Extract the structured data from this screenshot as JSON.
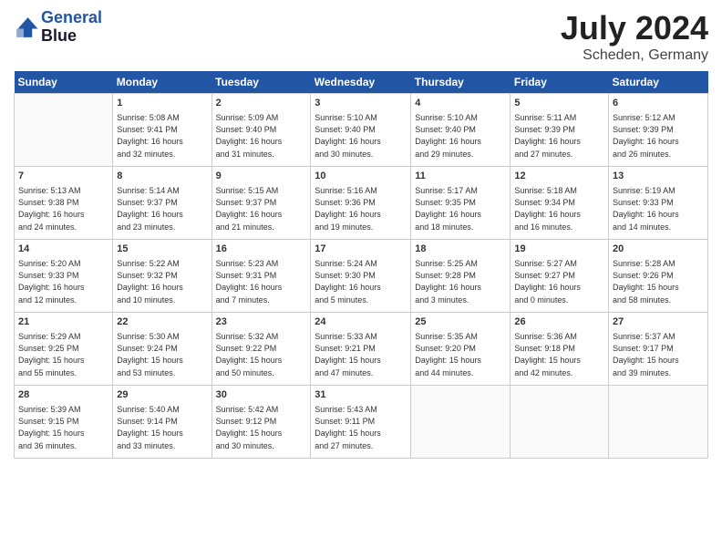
{
  "header": {
    "logo_line1": "General",
    "logo_line2": "Blue",
    "month": "July 2024",
    "location": "Scheden, Germany"
  },
  "weekdays": [
    "Sunday",
    "Monday",
    "Tuesday",
    "Wednesday",
    "Thursday",
    "Friday",
    "Saturday"
  ],
  "weeks": [
    [
      {
        "day": "",
        "info": ""
      },
      {
        "day": "1",
        "info": "Sunrise: 5:08 AM\nSunset: 9:41 PM\nDaylight: 16 hours\nand 32 minutes."
      },
      {
        "day": "2",
        "info": "Sunrise: 5:09 AM\nSunset: 9:40 PM\nDaylight: 16 hours\nand 31 minutes."
      },
      {
        "day": "3",
        "info": "Sunrise: 5:10 AM\nSunset: 9:40 PM\nDaylight: 16 hours\nand 30 minutes."
      },
      {
        "day": "4",
        "info": "Sunrise: 5:10 AM\nSunset: 9:40 PM\nDaylight: 16 hours\nand 29 minutes."
      },
      {
        "day": "5",
        "info": "Sunrise: 5:11 AM\nSunset: 9:39 PM\nDaylight: 16 hours\nand 27 minutes."
      },
      {
        "day": "6",
        "info": "Sunrise: 5:12 AM\nSunset: 9:39 PM\nDaylight: 16 hours\nand 26 minutes."
      }
    ],
    [
      {
        "day": "7",
        "info": "Sunrise: 5:13 AM\nSunset: 9:38 PM\nDaylight: 16 hours\nand 24 minutes."
      },
      {
        "day": "8",
        "info": "Sunrise: 5:14 AM\nSunset: 9:37 PM\nDaylight: 16 hours\nand 23 minutes."
      },
      {
        "day": "9",
        "info": "Sunrise: 5:15 AM\nSunset: 9:37 PM\nDaylight: 16 hours\nand 21 minutes."
      },
      {
        "day": "10",
        "info": "Sunrise: 5:16 AM\nSunset: 9:36 PM\nDaylight: 16 hours\nand 19 minutes."
      },
      {
        "day": "11",
        "info": "Sunrise: 5:17 AM\nSunset: 9:35 PM\nDaylight: 16 hours\nand 18 minutes."
      },
      {
        "day": "12",
        "info": "Sunrise: 5:18 AM\nSunset: 9:34 PM\nDaylight: 16 hours\nand 16 minutes."
      },
      {
        "day": "13",
        "info": "Sunrise: 5:19 AM\nSunset: 9:33 PM\nDaylight: 16 hours\nand 14 minutes."
      }
    ],
    [
      {
        "day": "14",
        "info": "Sunrise: 5:20 AM\nSunset: 9:33 PM\nDaylight: 16 hours\nand 12 minutes."
      },
      {
        "day": "15",
        "info": "Sunrise: 5:22 AM\nSunset: 9:32 PM\nDaylight: 16 hours\nand 10 minutes."
      },
      {
        "day": "16",
        "info": "Sunrise: 5:23 AM\nSunset: 9:31 PM\nDaylight: 16 hours\nand 7 minutes."
      },
      {
        "day": "17",
        "info": "Sunrise: 5:24 AM\nSunset: 9:30 PM\nDaylight: 16 hours\nand 5 minutes."
      },
      {
        "day": "18",
        "info": "Sunrise: 5:25 AM\nSunset: 9:28 PM\nDaylight: 16 hours\nand 3 minutes."
      },
      {
        "day": "19",
        "info": "Sunrise: 5:27 AM\nSunset: 9:27 PM\nDaylight: 16 hours\nand 0 minutes."
      },
      {
        "day": "20",
        "info": "Sunrise: 5:28 AM\nSunset: 9:26 PM\nDaylight: 15 hours\nand 58 minutes."
      }
    ],
    [
      {
        "day": "21",
        "info": "Sunrise: 5:29 AM\nSunset: 9:25 PM\nDaylight: 15 hours\nand 55 minutes."
      },
      {
        "day": "22",
        "info": "Sunrise: 5:30 AM\nSunset: 9:24 PM\nDaylight: 15 hours\nand 53 minutes."
      },
      {
        "day": "23",
        "info": "Sunrise: 5:32 AM\nSunset: 9:22 PM\nDaylight: 15 hours\nand 50 minutes."
      },
      {
        "day": "24",
        "info": "Sunrise: 5:33 AM\nSunset: 9:21 PM\nDaylight: 15 hours\nand 47 minutes."
      },
      {
        "day": "25",
        "info": "Sunrise: 5:35 AM\nSunset: 9:20 PM\nDaylight: 15 hours\nand 44 minutes."
      },
      {
        "day": "26",
        "info": "Sunrise: 5:36 AM\nSunset: 9:18 PM\nDaylight: 15 hours\nand 42 minutes."
      },
      {
        "day": "27",
        "info": "Sunrise: 5:37 AM\nSunset: 9:17 PM\nDaylight: 15 hours\nand 39 minutes."
      }
    ],
    [
      {
        "day": "28",
        "info": "Sunrise: 5:39 AM\nSunset: 9:15 PM\nDaylight: 15 hours\nand 36 minutes."
      },
      {
        "day": "29",
        "info": "Sunrise: 5:40 AM\nSunset: 9:14 PM\nDaylight: 15 hours\nand 33 minutes."
      },
      {
        "day": "30",
        "info": "Sunrise: 5:42 AM\nSunset: 9:12 PM\nDaylight: 15 hours\nand 30 minutes."
      },
      {
        "day": "31",
        "info": "Sunrise: 5:43 AM\nSunset: 9:11 PM\nDaylight: 15 hours\nand 27 minutes."
      },
      {
        "day": "",
        "info": ""
      },
      {
        "day": "",
        "info": ""
      },
      {
        "day": "",
        "info": ""
      }
    ]
  ]
}
